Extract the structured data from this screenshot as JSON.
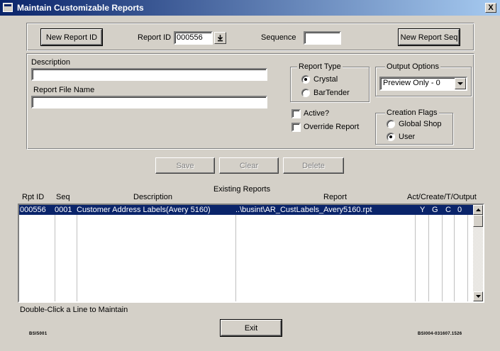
{
  "window": {
    "title": "Maintain Customizable Reports",
    "close_glyph": "X"
  },
  "top": {
    "new_report_id_label": "New Report ID",
    "report_id_label": "Report ID",
    "report_id_value": "000556",
    "sequence_label": "Sequence",
    "sequence_value": "",
    "new_report_seq_label": "New Report Seq"
  },
  "details": {
    "description_label": "Description",
    "description_value": "",
    "report_file_name_label": "Report File Name",
    "report_file_name_value": ""
  },
  "report_type": {
    "legend": "Report Type",
    "options": [
      "Crystal",
      "BarTender"
    ],
    "selected": "Crystal"
  },
  "output_options": {
    "legend": "Output Options",
    "selected": "Preview Only - 0"
  },
  "checks": {
    "active_label": "Active?",
    "active": false,
    "override_label": "Override Report",
    "override": false
  },
  "creation_flags": {
    "legend": "Creation Flags",
    "options": [
      "Global Shop",
      "User"
    ],
    "selected": "User"
  },
  "actions": {
    "save": "Save",
    "clear": "Clear",
    "delete": "Delete"
  },
  "list": {
    "section_title": "Existing Reports",
    "headers": {
      "rpt_id": "Rpt ID",
      "seq": "Seq",
      "description": "Description",
      "report": "Report",
      "flags": "Act/Create/T/Output"
    },
    "rows": [
      {
        "rpt_id": "000556",
        "seq": "0001",
        "description": "Customer Address Labels(Avery 5160)",
        "report": "..\\busint\\AR_CustLabels_Avery5160.rpt",
        "act": "Y",
        "create": "G",
        "t": "C",
        "output": "0"
      }
    ]
  },
  "hint": "Double-Click a Line to Maintain",
  "exit_label": "Exit",
  "footer": {
    "left_code": "BSI5001",
    "right_code": "BSI004-031607.1526"
  },
  "colors": {
    "selection": "#0a246a",
    "face": "#d4d0c8",
    "title_gradient_end": "#a6caf0"
  }
}
